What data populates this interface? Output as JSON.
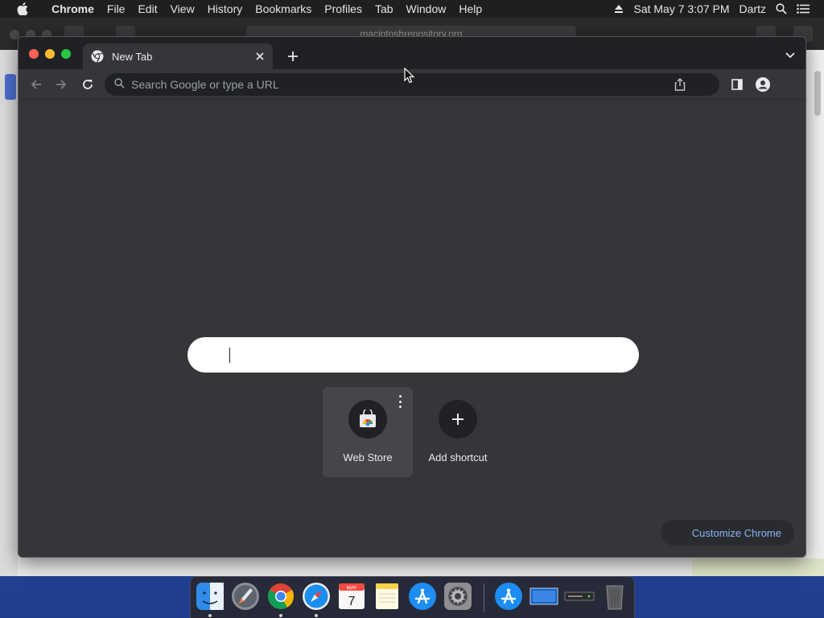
{
  "menubar": {
    "app_name": "Chrome",
    "items": [
      "File",
      "Edit",
      "View",
      "History",
      "Bookmarks",
      "Profiles",
      "Tab",
      "Window",
      "Help"
    ],
    "datetime": "Sat May 7  3:07 PM",
    "user": "Dartz"
  },
  "background_window": {
    "url": "macintoshrepository.org"
  },
  "chrome": {
    "tab": {
      "title": "New Tab"
    },
    "omnibox": {
      "placeholder": "Search Google or type a URL"
    },
    "shortcuts": [
      {
        "label": "Web Store"
      },
      {
        "label": "Add shortcut"
      }
    ],
    "customize_label": "Customize Chrome"
  },
  "dock": {
    "apps": [
      "Finder",
      "Launchpad",
      "Google Chrome",
      "Safari",
      "Calendar",
      "Notes",
      "App Store",
      "System Preferences",
      "Downloads",
      "Screen",
      "Disk",
      "Trash"
    ],
    "calendar": {
      "month": "MAY",
      "day": "7"
    }
  },
  "colors": {
    "chrome_bg": "#35363a",
    "tabstrip_bg": "#202124",
    "accent_link": "#8ab4f8"
  }
}
